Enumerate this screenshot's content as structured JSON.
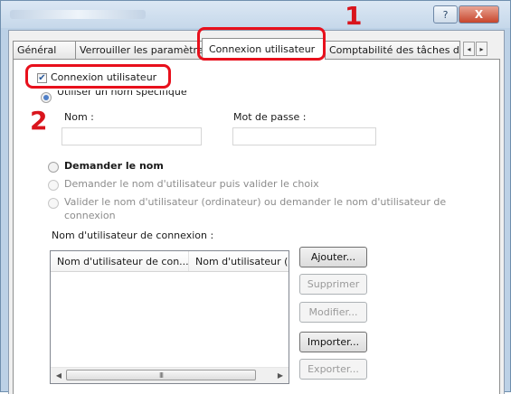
{
  "window": {
    "help_label": "?",
    "close_label": "X"
  },
  "tabs": [
    {
      "label": "Général"
    },
    {
      "label": "Verrouiller les paramètres"
    },
    {
      "label": "Connexion utilisateur"
    },
    {
      "label": "Comptabilité des tâches d'i"
    }
  ],
  "tab_scroll": {
    "left": "◂",
    "right": "▸"
  },
  "login": {
    "checkbox_label": "Connexion utilisateur",
    "checked": true,
    "specific_name_option": "Utiliser un nom spécifique",
    "name_label": "Nom :",
    "password_label": "Mot de passe :",
    "name_value": "",
    "password_value": "",
    "ask_name_option": "Demander le nom",
    "ask_name_validate_option": "Demander le nom d'utilisateur puis valider le choix",
    "validate_computer_option_line1": "Valider le nom d'utilisateur (ordinateur) ou demander le nom d'utilisateur de",
    "validate_computer_option_line2": "connexion"
  },
  "login_names": {
    "label": "Nom d'utilisateur de connexion :",
    "columns": [
      "Nom d'utilisateur de con...",
      "Nom d'utilisateur ("
    ],
    "rows": [],
    "scroll_thumb": "III"
  },
  "buttons": {
    "add": "Ajouter...",
    "delete": "Supprimer",
    "edit": "Modifier...",
    "import": "Importer...",
    "export": "Exporter..."
  },
  "callouts": {
    "step1": "1",
    "step2": "2"
  },
  "colors": {
    "callout_red": "#e8101c",
    "accent_blue": "#4f7fc7"
  }
}
